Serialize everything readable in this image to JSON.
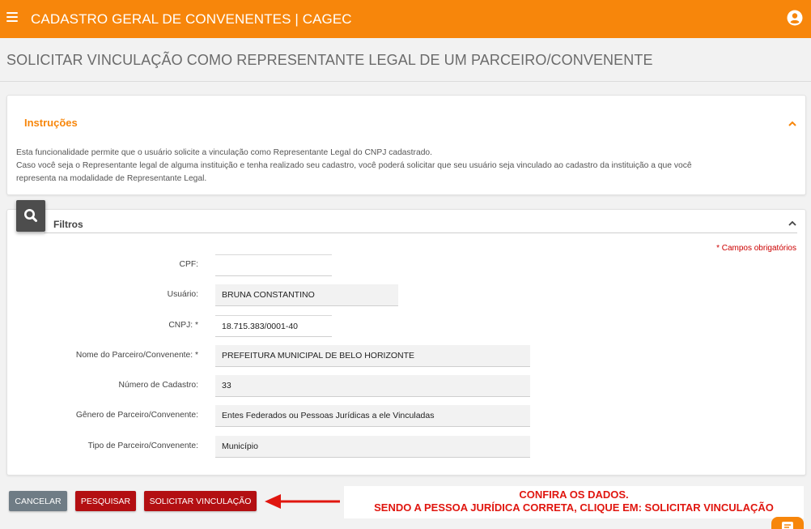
{
  "header": {
    "app_title": "CADASTRO GERAL DE CONVENENTES | CAGEC",
    "menu_icon": "hamburger-menu-icon",
    "user_icon": "user-account-icon",
    "brand_color": "#f7860b"
  },
  "page_title": "SOLICITAR VINCULAÇÃO COMO REPRESENTANTE LEGAL DE UM PARCEIRO/CONVENENTE",
  "instructions": {
    "title": "Instruções",
    "line1": "Esta funcionalidade permite que o usuário solicite a vinculação como Representante Legal do CNPJ cadastrado.",
    "line2": "Caso você seja o Representante legal de alguma instituição e tenha realizado seu cadastro, você poderá solicitar que seu usuário seja vinculado ao cadastro da instituição a que você",
    "line3": "representa na modalidade de Representante Legal."
  },
  "filters": {
    "title": "Filtros",
    "required_note": "* Campos obrigatórios",
    "fields": [
      {
        "label": "CPF:",
        "value": ""
      },
      {
        "label": "Usuário:",
        "value": "BRUNA CONSTANTINO"
      },
      {
        "label": "CNPJ: *",
        "value": "18.715.383/0001-40"
      },
      {
        "label": "Nome do Parceiro/Convenente: *",
        "value": "PREFEITURA MUNICIPAL DE BELO HORIZONTE"
      },
      {
        "label": "Número de Cadastro:",
        "value": "33"
      },
      {
        "label": "Gênero de Parceiro/Convenente:",
        "value": "Entes Federados ou Pessoas Jurídicas a ele Vinculadas"
      },
      {
        "label": "Tipo de Parceiro/Convenente:",
        "value": "Município"
      }
    ]
  },
  "actions": {
    "cancel": "CANCELAR",
    "search": "PESQUISAR",
    "request_link": "SOLICITAR VINCULAÇÃO"
  },
  "annotation": {
    "line1": "CONFIRA OS DADOS.",
    "line2": "SENDO A PESSOA JURÍDICA CORRETA, CLIQUE EM: SOLICITAR VINCULAÇÃO",
    "color": "#e0160f"
  }
}
